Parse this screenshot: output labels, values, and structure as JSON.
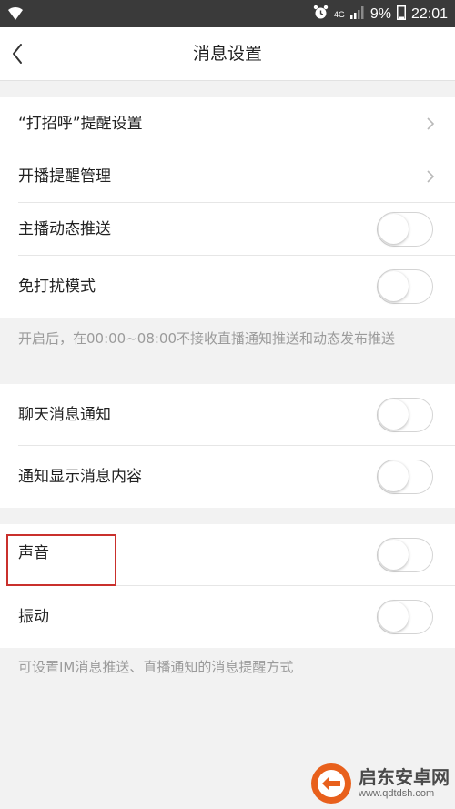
{
  "status_bar": {
    "network": "4G",
    "battery": "9%",
    "time": "22:01",
    "icons": [
      "wifi-icon",
      "alarm-icon",
      "signal-icon",
      "battery-icon"
    ]
  },
  "header": {
    "title": "消息设置",
    "back_icon": "chevron-left-icon"
  },
  "groups": {
    "greeting": {
      "label": "“打招呼”提醒设置"
    },
    "live": {
      "broadcast_mgmt": "开播提醒管理",
      "anchor_push": "主播动态推送",
      "do_not_disturb": "免打扰模式",
      "hint": "开启后，在00:00~08:00不接收直播通知推送和动态发布推送"
    },
    "chat": {
      "chat_notify": "聊天消息通知",
      "show_content": "通知显示消息内容"
    },
    "alert": {
      "sound": "声音",
      "vibrate": "振动",
      "hint": "可设置IM消息推送、直播通知的消息提醒方式"
    }
  },
  "toggles": {
    "anchor_push": false,
    "do_not_disturb": false,
    "chat_notify": false,
    "show_content": false,
    "sound": false,
    "vibrate": false
  },
  "watermark": {
    "title": "启东安卓网",
    "url": "www.qdtdsh.com"
  },
  "colors": {
    "status_bar": "#3a3a3a",
    "page_bg": "#f2f2f2",
    "highlight": "#c9302c",
    "hint_text": "#9b9b9b"
  }
}
